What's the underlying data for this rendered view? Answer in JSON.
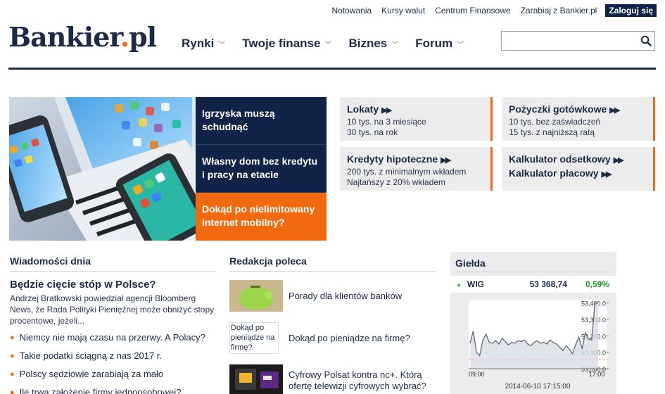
{
  "top_links": [
    "Notowania",
    "Kursy walut",
    "Centrum Finansowe",
    "Zarabiaj z Bankier.pl"
  ],
  "login_label": "Zaloguj się",
  "logo": {
    "text": "Bankier",
    "dot": ".",
    "suffix": "pl"
  },
  "nav": [
    "Rynki",
    "Twoje finanse",
    "Biznes",
    "Forum"
  ],
  "search": {
    "value": "",
    "placeholder": ""
  },
  "hero": {
    "items": [
      "Igrzyska muszą schudnąć",
      "Własny dom bez kredytu i pracy na etacie",
      "Dokąd po nielimitowany internet mobilny?"
    ]
  },
  "boxes": {
    "lokaty": {
      "title": "Lokaty",
      "lines": [
        "10 tys. na 3 miesiące",
        "30 tys. na rok"
      ]
    },
    "pozyczki": {
      "title": "Pożyczki gotówkowe",
      "lines": [
        "10 tys. bez zaświadczeń",
        "15 tys. z najniższą ratą"
      ]
    },
    "kredyty": {
      "title": "Kredyty hipoteczne",
      "lines": [
        "200 tys. z minimalnym wkładem",
        "Najtańszy z 20% wkładem"
      ]
    },
    "kalkulatory": {
      "title_1": "Kalkulator odsetkowy",
      "title_2": "Kalkulator płacowy"
    }
  },
  "wiadomosci": {
    "section_title": "Wiadomości dnia",
    "lead_title": "Będzie cięcie stóp w Polsce?",
    "lead_body": "Andrzej Bratkowski powiedział agencji Bloomberg News, że Rada Polityki Pieniężnej może obniżyć stopy procentowe, jeżeli...",
    "items": [
      "Niemcy nie mają czasu na przerwy. A Polacy?",
      "Takie podatki ściągną z nas 2017 r.",
      "Polscy sędziowie zarabiają za mało",
      "Ile trwa założenie firmy jednoosobowej?"
    ]
  },
  "redakcja": {
    "section_title": "Redakcja poleca",
    "items": [
      {
        "text": "Porady dla klientów banków"
      },
      {
        "text": "Dokąd po pieniądze na firmę?",
        "thumb_alt": "Dokąd po pieniądze na firmę?"
      },
      {
        "text": "Cyfrowy Polsat kontra nc+. Którą ofertę telewizji cyfrowych wybrać?"
      }
    ]
  },
  "gielda": {
    "title": "Giełda",
    "index_name": "WIG",
    "value": "53 368,74",
    "change": "0,59%",
    "timestamp": "2014-06-10 17:15:00",
    "colors": {
      "up": "#1a9a1a",
      "accent": "#f06a14"
    }
  },
  "chart_data": {
    "type": "line",
    "title": "",
    "xlabel": "",
    "ylabel": "",
    "x_ticks": [
      "09:00",
      "17:00"
    ],
    "y_ticks": [
      "53,000.0",
      "53,100.0",
      "53,200.0",
      "53,300.0",
      "53,400.0"
    ],
    "ylim": [
      53000,
      53420
    ],
    "reference_line": 53055,
    "series": [
      {
        "values": [
          53155,
          53230,
          53100,
          53080,
          53175,
          53210,
          53160,
          53155,
          53170,
          53150,
          53185,
          53165,
          53145,
          53160,
          53155,
          53170,
          53165,
          53175,
          53150,
          53140,
          53160,
          53170,
          53155,
          53160,
          53150,
          53175,
          53160,
          53150,
          53130,
          53110,
          53140,
          53120,
          53090,
          53150,
          53190,
          53120,
          53220,
          53180,
          53175,
          53400,
          53400
        ]
      }
    ]
  }
}
